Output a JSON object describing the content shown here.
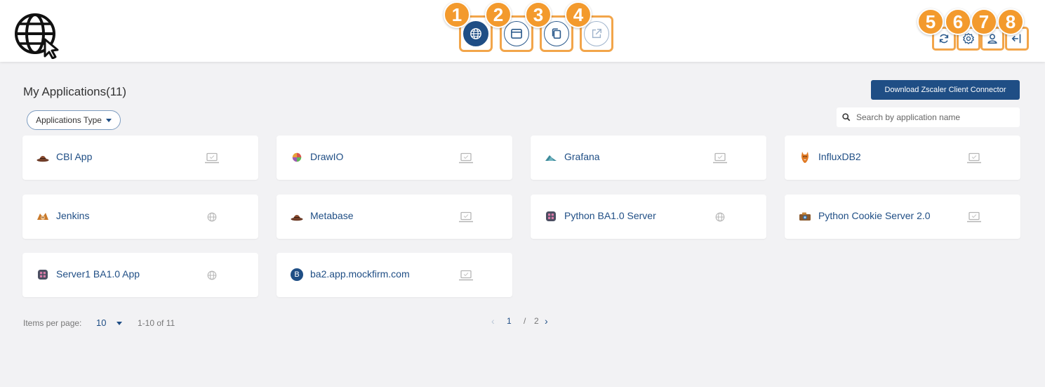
{
  "header": {
    "nav": [
      {
        "id": "applications",
        "icon": "globe-icon",
        "badge": "1",
        "active": true
      },
      {
        "id": "browser",
        "icon": "browser-window-icon",
        "badge": "2",
        "active": false
      },
      {
        "id": "copy",
        "icon": "copy-icon",
        "badge": "3",
        "active": false
      },
      {
        "id": "external",
        "icon": "external-link-icon",
        "badge": "4",
        "active": false
      }
    ],
    "tools": [
      {
        "id": "refresh",
        "icon": "refresh-icon",
        "badge": "5"
      },
      {
        "id": "settings",
        "icon": "gear-icon",
        "badge": "6"
      },
      {
        "id": "user",
        "icon": "user-icon",
        "badge": "7"
      },
      {
        "id": "logout",
        "icon": "logout-icon",
        "badge": "8"
      }
    ]
  },
  "main": {
    "title": "My Applications(11)",
    "download_label": "Download Zscaler Client Connector",
    "filter_label": "Applications Type",
    "search_placeholder": "Search by application name",
    "apps": [
      {
        "name": "CBI App",
        "icon": "hat-icon",
        "type": "laptop-icon"
      },
      {
        "name": "DrawIO",
        "icon": "drawio-icon",
        "type": "laptop-icon"
      },
      {
        "name": "Grafana",
        "icon": "grafana-icon",
        "type": "laptop-icon"
      },
      {
        "name": "InfluxDB2",
        "icon": "fox-icon",
        "type": "laptop-icon"
      },
      {
        "name": "Jenkins",
        "icon": "jenkins-icon",
        "type": "globe-icon"
      },
      {
        "name": "Metabase",
        "icon": "hat-icon",
        "type": "laptop-icon"
      },
      {
        "name": "Python BA1.0 Server",
        "icon": "server-icon",
        "type": "globe-icon"
      },
      {
        "name": "Python Cookie Server 2.0",
        "icon": "camera-icon",
        "type": "laptop-icon"
      },
      {
        "name": "Server1 BA1.0 App",
        "icon": "server-icon",
        "type": "globe-icon"
      },
      {
        "name": "ba2.app.mockfirm.com",
        "icon": "letter-b-icon",
        "letter": "B",
        "type": "laptop-icon"
      }
    ]
  },
  "pagination": {
    "items_label": "Items per page:",
    "per_page": "10",
    "range": "1-10 of 11",
    "prev": "‹",
    "current": "1",
    "separator": "/",
    "total": "2",
    "next": "›"
  },
  "colors": {
    "accent": "#1f4e85",
    "highlight": "#f39a2d",
    "background": "#f2f2f4"
  }
}
